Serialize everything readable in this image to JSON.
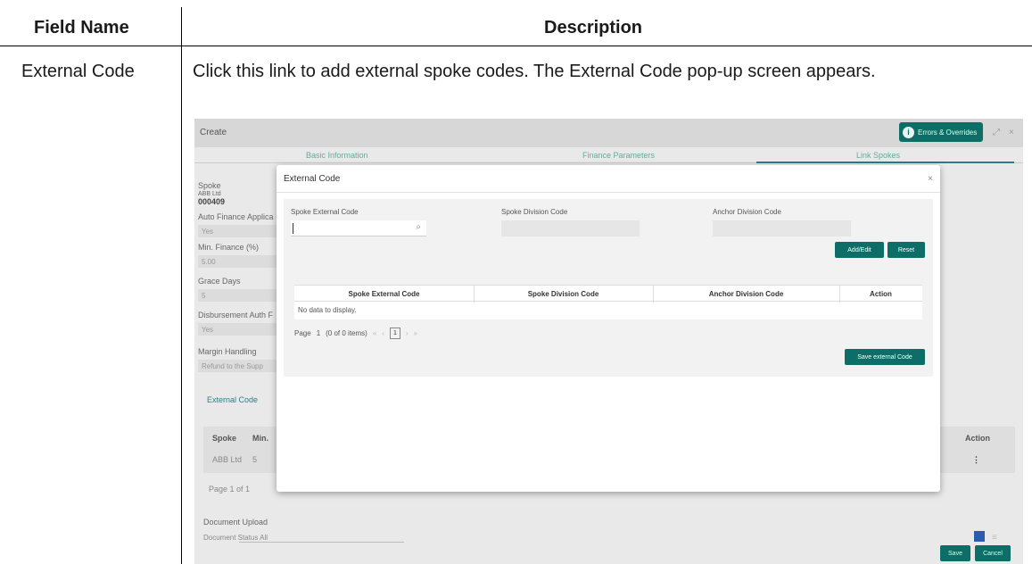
{
  "doc": {
    "header_field": "Field Name",
    "header_description": "Description",
    "row_field_name": "External Code",
    "row_description": "Click this link to add external spoke codes. The External Code pop-up screen appears."
  },
  "app": {
    "window_title": "Create",
    "errors_button": "Errors & Overrides",
    "tabs": [
      "Basic Information",
      "Finance Parameters",
      "Link Spokes"
    ],
    "active_tab": "Link Spokes",
    "spoke_label": "Spoke",
    "spoke_name": "ABB Ltd",
    "spoke_id": "000409",
    "fields": [
      {
        "label": "Auto Finance Applica",
        "value": "Yes"
      },
      {
        "label": "Min. Finance (%)",
        "value": "5.00"
      },
      {
        "label": "Grace Days",
        "value": "5"
      },
      {
        "label": "Disbursement Auth F",
        "value": "Yes"
      },
      {
        "label": "Margin Handling",
        "value": "Refund to the Supp"
      }
    ],
    "external_code_link": "External Code",
    "bg_table": {
      "headers": [
        "Spoke",
        "Min.",
        "Action"
      ],
      "row": [
        "ABB Ltd",
        "5"
      ],
      "action_icon": "⋮"
    },
    "bg_pager": "Page   1   of 1",
    "document_upload": "Document Upload",
    "document_status_label": "Document Status",
    "document_status_value": "All",
    "save": "Save",
    "cancel": "Cancel"
  },
  "modal": {
    "title": "External Code",
    "close": "×",
    "spoke_external_code_label": "Spoke External Code",
    "spoke_external_code_value": "",
    "spoke_division_code_label": "Spoke Division Code",
    "anchor_division_code_label": "Anchor Division Code",
    "add_edit": "Add/Edit",
    "reset": "Reset",
    "columns": [
      "Spoke External Code",
      "Spoke Division Code",
      "Anchor Division Code",
      "Action"
    ],
    "empty_message": "No data to display.",
    "pager_page_label": "Page",
    "pager_page": "1",
    "pager_items": "(0 of 0 items)",
    "pager_current": "1",
    "save_external": "Save external Code"
  },
  "icons": {
    "search": "⌕",
    "first": "«",
    "prev": "‹",
    "next": "›",
    "last": "»",
    "info": "i",
    "grid_view": "grid-view-icon",
    "list_view": "≡",
    "expand": "⤢",
    "close": "×"
  },
  "colors": {
    "primary_button": "#0c6e66",
    "active_tab": "#2a7d8a",
    "link": "#2a7d8a"
  }
}
